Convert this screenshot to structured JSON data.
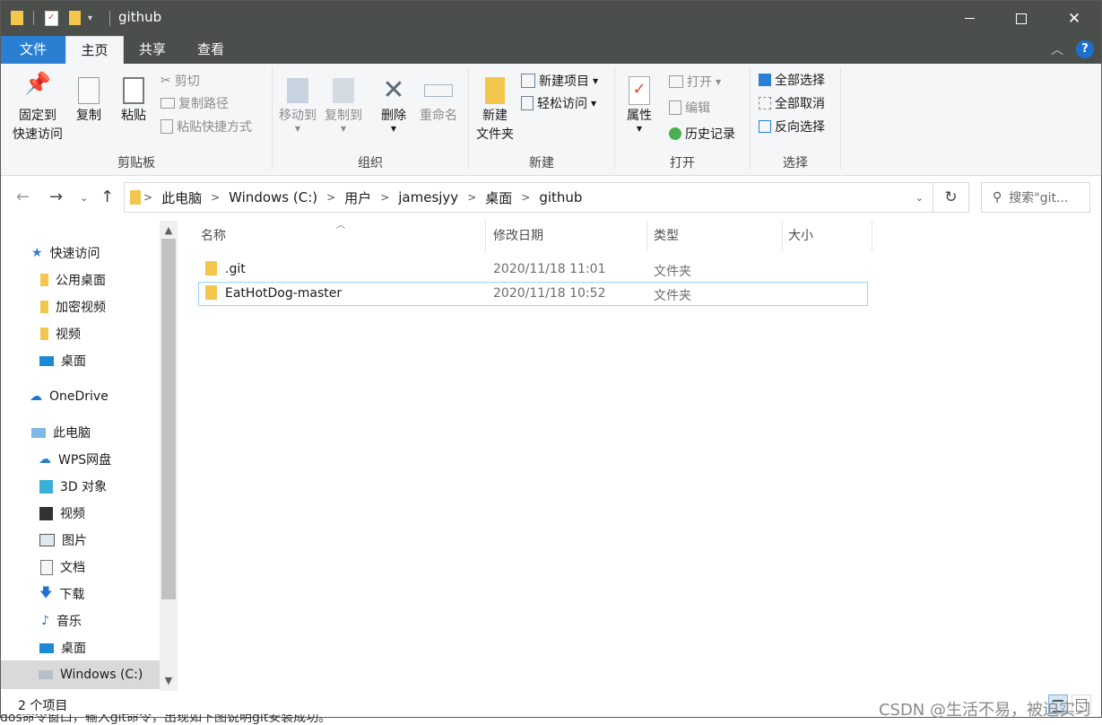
{
  "title": "github",
  "ribbon_tabs": {
    "file": "文件",
    "home": "主页",
    "share": "共享",
    "view": "查看"
  },
  "clipboard": {
    "group_label": "剪贴板",
    "pin_line1": "固定到",
    "pin_line2": "快速访问",
    "copy": "复制",
    "paste": "粘贴",
    "cut": "剪切",
    "copy_path": "复制路径",
    "paste_shortcut": "粘贴快捷方式"
  },
  "organize": {
    "group_label": "组织",
    "move_to": "移动到",
    "copy_to": "复制到",
    "delete": "删除",
    "rename": "重命名"
  },
  "new": {
    "group_label": "新建",
    "new_folder_line1": "新建",
    "new_folder_line2": "文件夹",
    "new_item": "新建项目",
    "easy_access": "轻松访问"
  },
  "open": {
    "group_label": "打开",
    "properties": "属性",
    "open": "打开",
    "edit": "编辑",
    "history": "历史记录"
  },
  "select": {
    "group_label": "选择",
    "select_all": "全部选择",
    "select_none": "全部取消",
    "invert": "反向选择"
  },
  "breadcrumb": [
    "此电脑",
    "Windows (C:)",
    "用户",
    "jamesjyy",
    "桌面",
    "github"
  ],
  "search": {
    "placeholder": "搜索\"git..."
  },
  "nav": {
    "quick_access": "快速访问",
    "qa_items": [
      "公用桌面",
      "加密视频",
      "视频",
      "桌面"
    ],
    "onedrive": "OneDrive",
    "this_pc": "此电脑",
    "pc_items": [
      "WPS网盘",
      "3D 对象",
      "视频",
      "图片",
      "文档",
      "下载",
      "音乐",
      "桌面",
      "Windows (C:)"
    ]
  },
  "columns": {
    "name": "名称",
    "date": "修改日期",
    "type": "类型",
    "size": "大小"
  },
  "files": [
    {
      "name": ".git",
      "date": "2020/11/18 11:01",
      "type": "文件夹",
      "size": ""
    },
    {
      "name": "EatHotDog-master",
      "date": "2020/11/18 10:52",
      "type": "文件夹",
      "size": ""
    }
  ],
  "status": {
    "count": "2 个项目"
  },
  "watermark": "CSDN @生活不易，被迫实习",
  "bottom_text": "dos命令窗口，输入git命令，出现如下图说明git安装成功。",
  "colors": {
    "accent": "#2b7fd2",
    "titlebar": "#4a4f4b",
    "ribbon": "#f5f6f7",
    "selection_border": "#99d1ff"
  }
}
